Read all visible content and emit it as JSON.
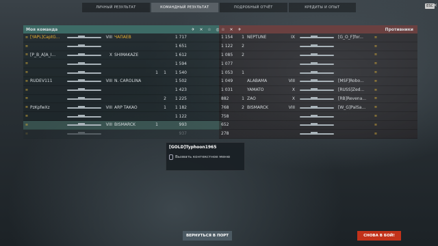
{
  "tabs": [
    {
      "label": "ЛИЧНЫЙ РЕЗУЛЬТАТ"
    },
    {
      "label": "КОМАНДНЫЙ РЕЗУЛЬТАТ"
    },
    {
      "label": "ПОДРОБНЫЙ ОТЧЁТ"
    },
    {
      "label": "КРЕДИТЫ И ОПЫТ"
    }
  ],
  "esc_label": "ESC",
  "close_label": "✕",
  "my_team": {
    "title": "Моя команда",
    "rows": [
      {
        "player": "[YAPL]CaptG...",
        "tier": "VIII",
        "ship": "ЧАПАЕВ",
        "frags": "",
        "caps": "",
        "score": "1 717"
      },
      {
        "player": "",
        "tier": "",
        "ship": "",
        "frags": "",
        "caps": "",
        "score": "1 651"
      },
      {
        "player": "[P_B_A]A_I...",
        "tier": "X",
        "ship": "SHIMAKAZE",
        "frags": "",
        "caps": "",
        "score": "1 612"
      },
      {
        "player": "",
        "tier": "",
        "ship": "",
        "frags": "",
        "caps": "",
        "score": "1 594"
      },
      {
        "player": "",
        "tier": "",
        "ship": "",
        "frags": "1",
        "caps": "1",
        "score": "1 540"
      },
      {
        "player": "RUDEV111",
        "tier": "VIII",
        "ship": "N. CAROLINA",
        "frags": "",
        "caps": "",
        "score": "1 502"
      },
      {
        "player": "",
        "tier": "",
        "ship": "",
        "frags": "",
        "caps": "",
        "score": "1 423"
      },
      {
        "player": "",
        "tier": "",
        "ship": "",
        "frags": "",
        "caps": "2",
        "score": "1 225"
      },
      {
        "player": "PzKpfwXz",
        "tier": "VIII",
        "ship": "ARP TAKAO",
        "frags": "",
        "caps": "1",
        "score": "1 182"
      },
      {
        "player": "",
        "tier": "",
        "ship": "",
        "frags": "",
        "caps": "",
        "score": "1 122"
      },
      {
        "player": "",
        "tier": "VIII",
        "ship": "BISMARCK",
        "frags": "1",
        "caps": "",
        "score": "993"
      },
      {
        "player": "",
        "tier": "",
        "ship": "",
        "frags": "",
        "caps": "",
        "score": "937"
      }
    ]
  },
  "enemy_team": {
    "title": "Противники",
    "rows": [
      {
        "score": "1 154",
        "frags": "1",
        "ship": "NEPTUNE",
        "tier": "IX",
        "player": "[G_O_F]for..."
      },
      {
        "score": "1 122",
        "frags": "2",
        "ship": "",
        "tier": "",
        "player": ""
      },
      {
        "score": "1 085",
        "frags": "2",
        "ship": "",
        "tier": "",
        "player": ""
      },
      {
        "score": "1 077",
        "frags": "",
        "ship": "",
        "tier": "",
        "player": ""
      },
      {
        "score": "1 053",
        "frags": "1",
        "ship": "",
        "tier": "",
        "player": ""
      },
      {
        "score": "1 049",
        "frags": "",
        "ship": "ALABAMA",
        "tier": "VIII",
        "player": "[MSF]Robo..."
      },
      {
        "score": "1 031",
        "frags": "",
        "ship": "YAMATO",
        "tier": "X",
        "player": "[RUSS]Zed..."
      },
      {
        "score": "882",
        "frags": "1",
        "ship": "ZAO",
        "tier": "X",
        "player": "[RB]Revena..."
      },
      {
        "score": "768",
        "frags": "2",
        "ship": "BISMARCK",
        "tier": "VIII",
        "player": "[W_G]PalSa..."
      },
      {
        "score": "758",
        "frags": "",
        "ship": "",
        "tier": "",
        "player": ""
      },
      {
        "score": "652",
        "frags": "",
        "ship": "",
        "tier": "",
        "player": ""
      },
      {
        "score": "278",
        "frags": "",
        "ship": "",
        "tier": "",
        "player": ""
      }
    ]
  },
  "popup": {
    "player": "[GOLD]Typhoon1965",
    "action": "Вызвать контекстное меню"
  },
  "buttons": {
    "port": "ВЕРНУТЬСЯ В ПОРТ",
    "battle": "СНОВА В БОЙ!"
  }
}
